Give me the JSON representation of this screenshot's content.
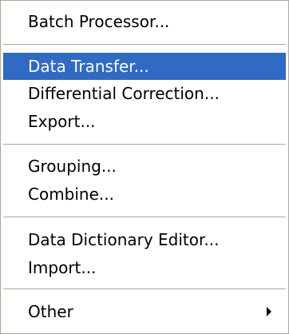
{
  "menu": {
    "groups": [
      {
        "items": [
          {
            "label": "Batch Processor..."
          }
        ]
      },
      {
        "items": [
          {
            "label": "Data Transfer...",
            "highlighted": true
          },
          {
            "label": "Differential Correction..."
          },
          {
            "label": "Export..."
          }
        ]
      },
      {
        "items": [
          {
            "label": "Grouping..."
          },
          {
            "label": "Combine..."
          }
        ]
      },
      {
        "items": [
          {
            "label": "Data Dictionary Editor..."
          },
          {
            "label": "Import..."
          }
        ]
      },
      {
        "items": [
          {
            "label": "Other",
            "submenu": true,
            "submenu_icon": "submenu-arrow-icon"
          }
        ]
      }
    ],
    "colors": {
      "highlight_background": "#316ac5",
      "highlight_text": "#ffffff",
      "separator": "#aca899"
    }
  }
}
